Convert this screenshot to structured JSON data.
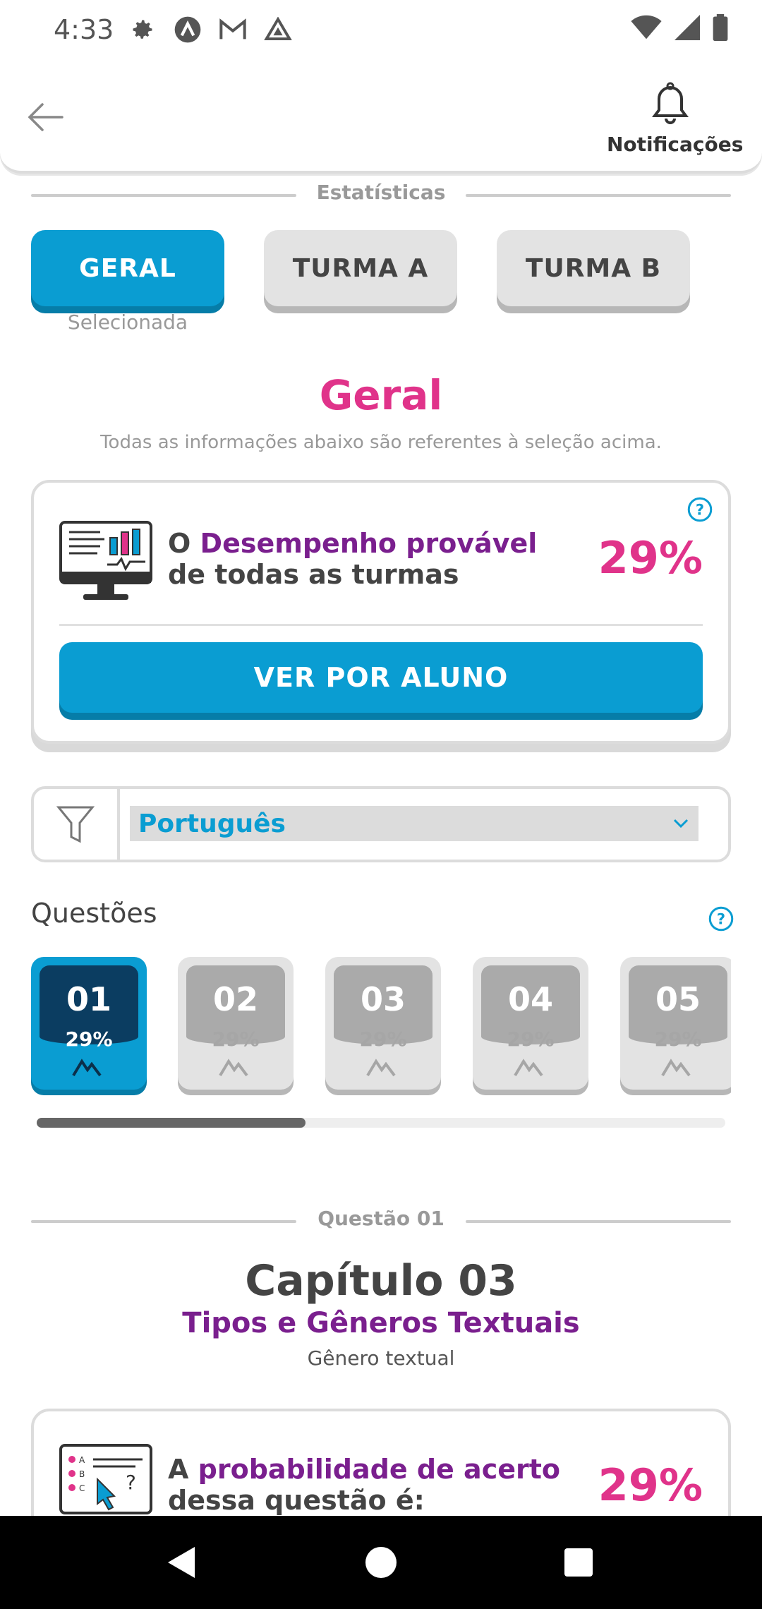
{
  "status_bar": {
    "time": "4:33",
    "icons": [
      "settings-icon",
      "a-app-icon",
      "gmail-icon",
      "drive-icon"
    ],
    "right_icons": [
      "wifi-icon",
      "signal-icon",
      "battery-icon"
    ]
  },
  "header": {
    "back": "back-arrow-icon",
    "notifications_label": "Notificações"
  },
  "section_stats": "Estatísticas",
  "tabs": [
    {
      "label": "GERAL",
      "active": true
    },
    {
      "label": "TURMA A",
      "active": false
    },
    {
      "label": "TURMA B",
      "active": false
    }
  ],
  "tab_selected_label": "Selecionada",
  "main": {
    "title": "Geral",
    "subtitle": "Todas as informações abaixo são referentes à seleção acima."
  },
  "performance_card": {
    "prefix": "O ",
    "highlight": "Desempenho provável",
    "line2": "de todas as turmas",
    "percent": "29%",
    "button": "VER POR ALUNO"
  },
  "filter": {
    "value": "Português"
  },
  "questions": {
    "title": "Questões",
    "items": [
      {
        "num": "01",
        "pct": "29%",
        "active": true
      },
      {
        "num": "02",
        "pct": "29%",
        "active": false
      },
      {
        "num": "03",
        "pct": "29%",
        "active": false
      },
      {
        "num": "04",
        "pct": "29%",
        "active": false
      },
      {
        "num": "05",
        "pct": "29%",
        "active": false
      }
    ],
    "scroll_fraction": 0.39
  },
  "question_section": "Questão 01",
  "chapter": {
    "title": "Capítulo 03",
    "subtitle": "Tipos e Gêneros Textuais",
    "topic": "Gênero textual"
  },
  "probability_card": {
    "prefix": "A ",
    "highlight": "probabilidade de acerto",
    "line2": "dessa questão é:",
    "percent": "29%"
  },
  "colors": {
    "accent_blue": "#0a9dd2",
    "pink": "#e0338a",
    "purple": "#7a1f8e",
    "dark_navy": "#0b3d61"
  }
}
